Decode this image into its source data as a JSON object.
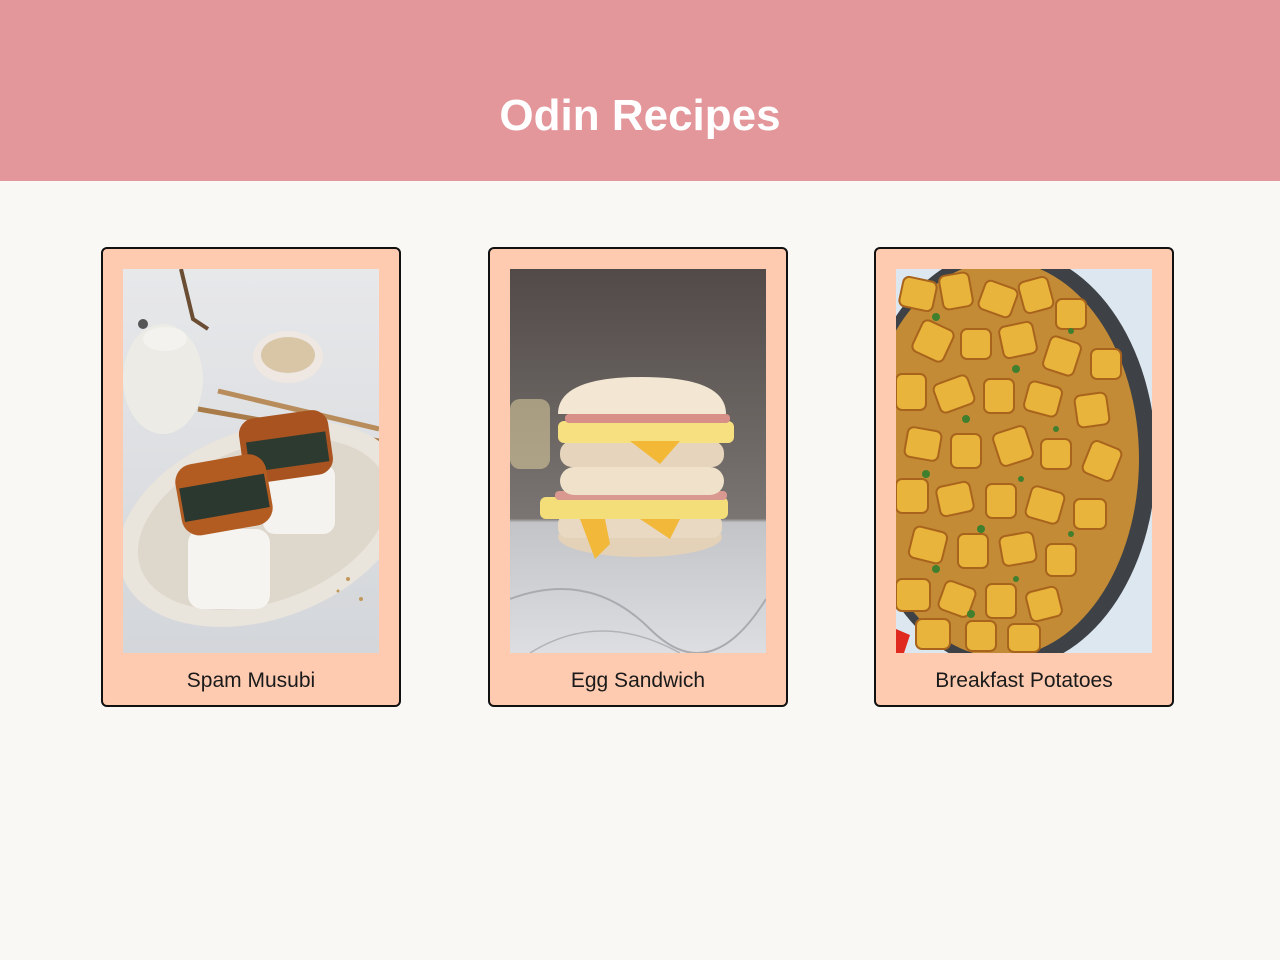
{
  "header": {
    "title": "Odin Recipes"
  },
  "recipes": [
    {
      "label": "Spam Musubi",
      "image": "spam-musubi-photo"
    },
    {
      "label": "Egg Sandwich",
      "image": "egg-sandwich-photo"
    },
    {
      "label": "Breakfast Potatoes",
      "image": "breakfast-potatoes-photo"
    }
  ],
  "colors": {
    "header_bg": "#e4979b",
    "page_bg": "#faf8f4",
    "card_bg": "#fecbb0",
    "card_border": "#111111"
  }
}
